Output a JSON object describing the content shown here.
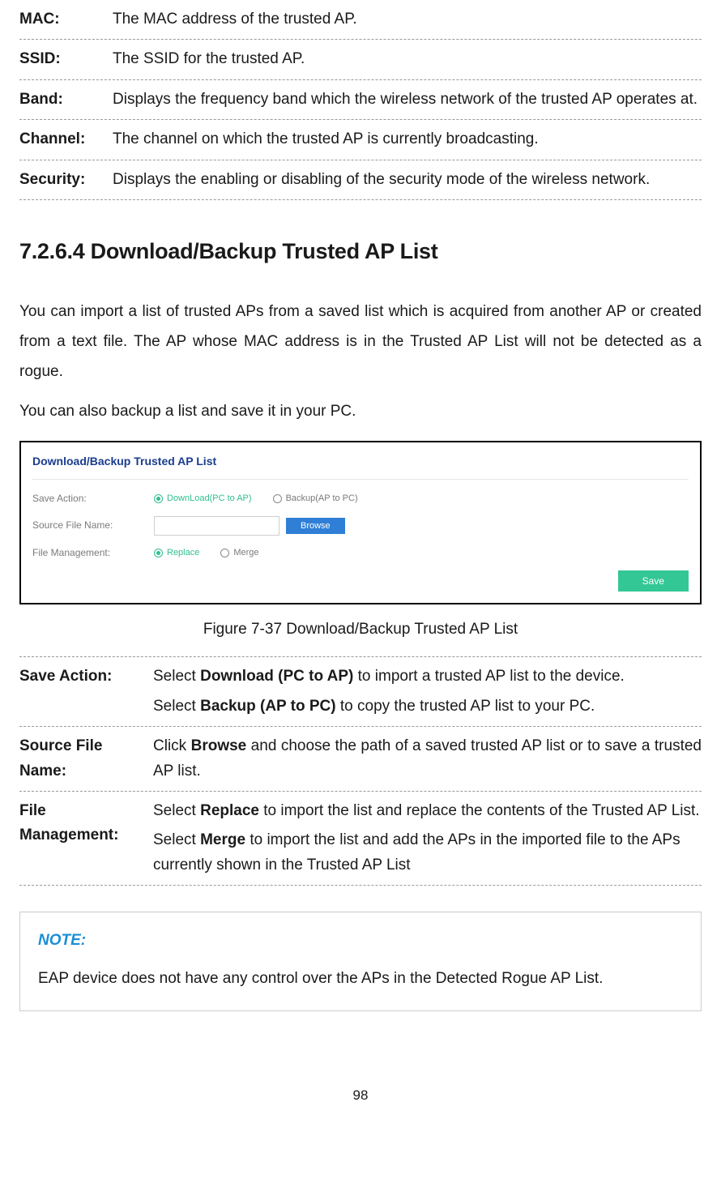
{
  "table1": {
    "rows": [
      {
        "term": "MAC:",
        "desc": "The MAC address of the trusted AP."
      },
      {
        "term": "SSID:",
        "desc": "The SSID for the trusted AP."
      },
      {
        "term": "Band:",
        "desc": "Displays the frequency band which the wireless network of the trusted AP operates at."
      },
      {
        "term": "Channel:",
        "desc": "The channel on which the trusted AP is currently broadcasting."
      },
      {
        "term": "Security:",
        "desc": "Displays the enabling or disabling of the security mode of the wireless network."
      }
    ]
  },
  "heading": "7.2.6.4  Download/Backup Trusted AP List",
  "paragraphs": [
    "You can import a list of trusted APs from a saved list which is acquired from another AP or created from a text file. The AP whose MAC address is in the Trusted AP List will not be detected as a rogue.",
    "You can also backup a list and save it in your PC."
  ],
  "screenshot": {
    "title": "Download/Backup Trusted AP List",
    "rows": {
      "save_action": {
        "label": "Save Action:",
        "opt1": "DownLoad(PC to AP)",
        "opt2": "Backup(AP to PC)"
      },
      "source": {
        "label": "Source File Name:",
        "browse": "Browse"
      },
      "file_mgmt": {
        "label": "File Management:",
        "opt1": "Replace",
        "opt2": "Merge"
      }
    },
    "save_btn": "Save"
  },
  "figure_caption": "Figure 7-37 Download/Backup Trusted AP List",
  "table2": {
    "rows": [
      {
        "term": "Save Action:",
        "para1": {
          "pre": "Select ",
          "bold": "Download (PC to AP)",
          "post": " to import a trusted AP list to the device."
        },
        "para2": {
          "pre": "Select ",
          "bold": "Backup (AP to PC)",
          "post": " to copy the trusted AP list to your PC."
        }
      },
      {
        "term": "Source File Name:",
        "para1": {
          "pre": "Click ",
          "bold": "Browse",
          "post": " and choose the path of a saved trusted AP list or to save a trusted AP list."
        }
      },
      {
        "term": "File Management:",
        "para1": {
          "pre": "Select ",
          "bold": "Replace",
          "post": " to import the list and replace the contents of the Trusted AP List."
        },
        "para2": {
          "pre": "Select ",
          "bold": "Merge",
          "post": " to import the list and add the APs in the imported file to the APs currently shown in the Trusted AP List"
        }
      }
    ]
  },
  "note": {
    "title": "NOTE:",
    "body": "EAP device does not have any control over the APs in the Detected Rogue AP List."
  },
  "page_number": "98"
}
